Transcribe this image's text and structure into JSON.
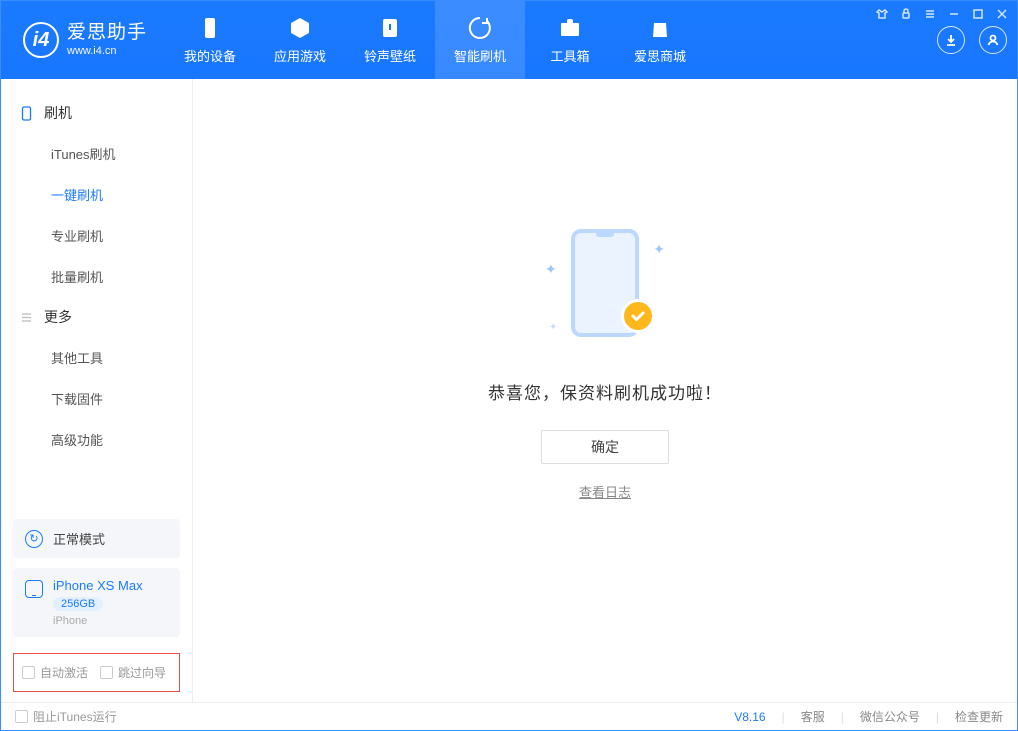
{
  "app": {
    "title": "爱思助手",
    "url": "www.i4.cn"
  },
  "nav": {
    "device": "我的设备",
    "apps": "应用游戏",
    "ringtones": "铃声壁纸",
    "flash": "智能刷机",
    "toolbox": "工具箱",
    "store": "爱思商城"
  },
  "sidebar": {
    "group_flash": "刷机",
    "items_flash": {
      "itunes": "iTunes刷机",
      "oneclick": "一键刷机",
      "pro": "专业刷机",
      "batch": "批量刷机"
    },
    "group_more": "更多",
    "items_more": {
      "other": "其他工具",
      "firmware": "下载固件",
      "advanced": "高级功能"
    },
    "mode": "正常模式",
    "device": {
      "name": "iPhone XS Max",
      "storage": "256GB",
      "type": "iPhone"
    },
    "options": {
      "auto_activate": "自动激活",
      "skip_guide": "跳过向导"
    }
  },
  "content": {
    "success": "恭喜您，保资料刷机成功啦！",
    "ok": "确定",
    "log": "查看日志"
  },
  "footer": {
    "block_itunes": "阻止iTunes运行",
    "version": "V8.16",
    "service": "客服",
    "wechat": "微信公众号",
    "update": "检查更新"
  }
}
